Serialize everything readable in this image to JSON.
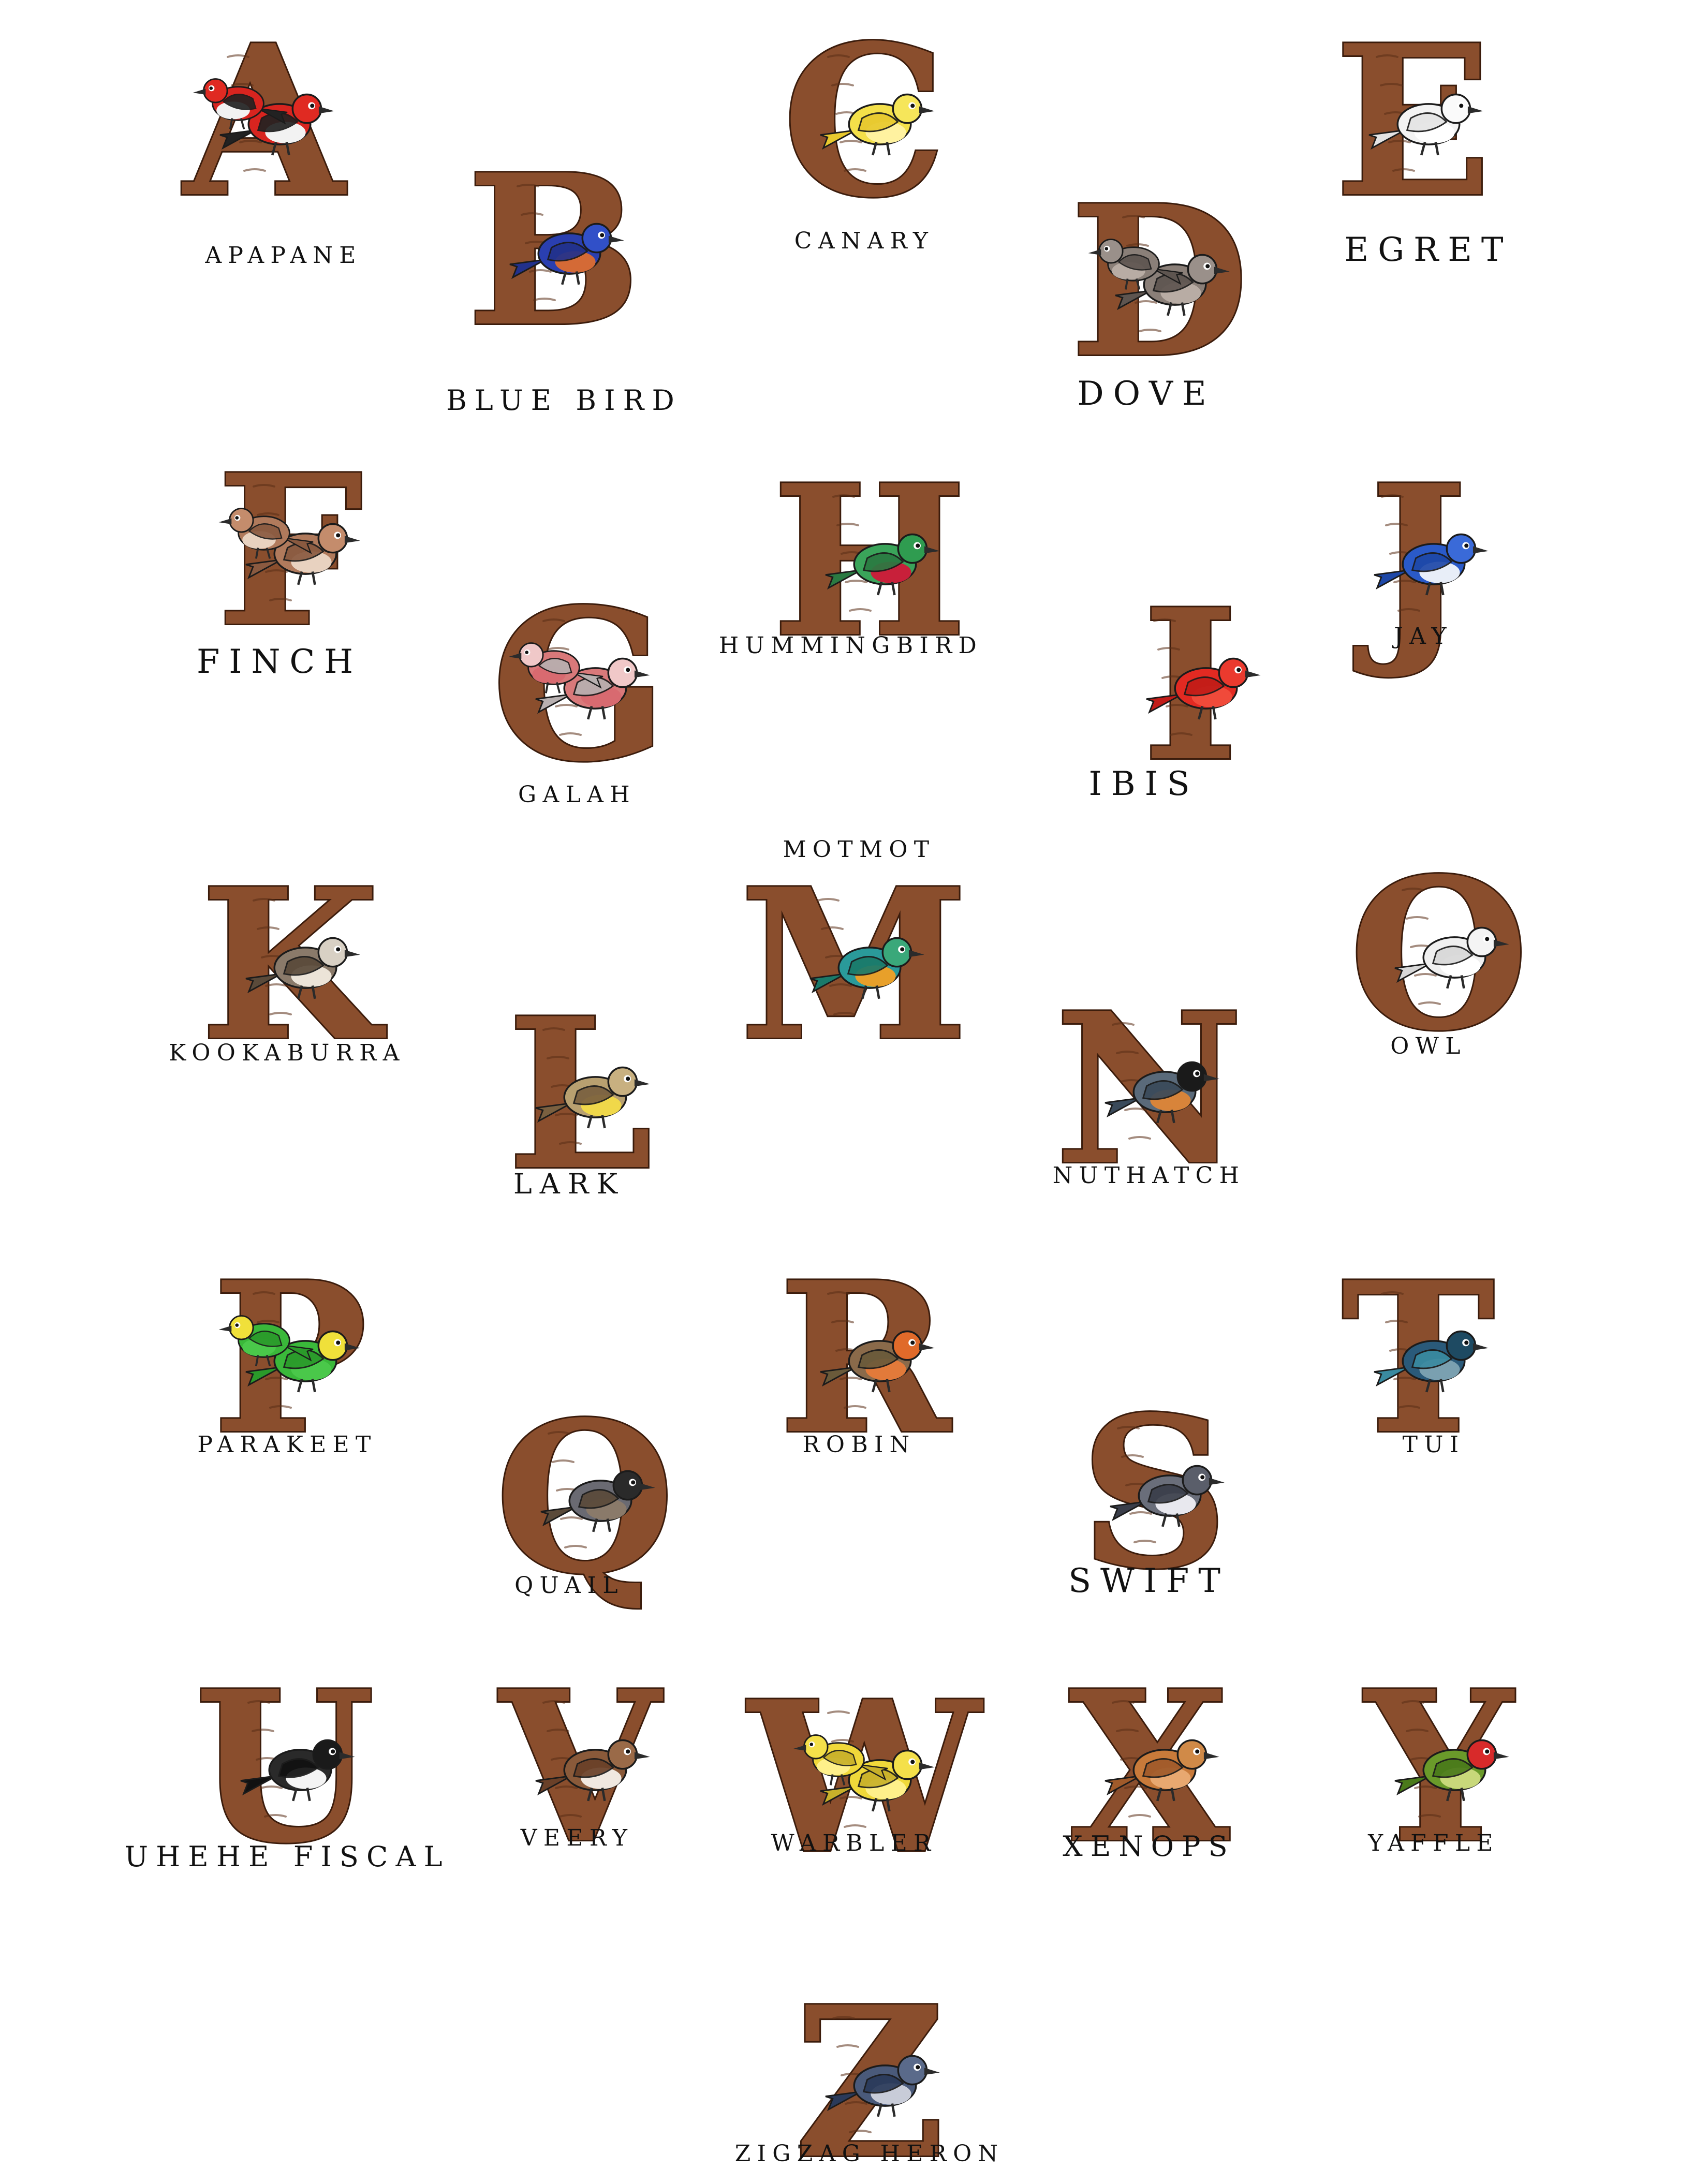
{
  "entries": [
    {
      "letter": "A",
      "name": "Apapane",
      "colors": {
        "body": "#d8241f",
        "wing": "#222222",
        "head": "#e02a22",
        "belly": "#f2f2f2"
      }
    },
    {
      "letter": "B",
      "name": "Blue Bird",
      "colors": {
        "body": "#2a3fb0",
        "wing": "#22318c",
        "head": "#3150c8",
        "belly": "#d46a36"
      }
    },
    {
      "letter": "C",
      "name": "Canary",
      "colors": {
        "body": "#f4e04a",
        "wing": "#e8c92e",
        "head": "#f6e65a",
        "belly": "#fff2a0"
      }
    },
    {
      "letter": "D",
      "name": "Dove",
      "colors": {
        "body": "#8a7f78",
        "wing": "#5e5550",
        "head": "#9a908a",
        "belly": "#b8aca4"
      }
    },
    {
      "letter": "E",
      "name": "Egret",
      "colors": {
        "body": "#f4f4f4",
        "wing": "#e4e4e4",
        "head": "#fafafa",
        "belly": "#ffffff"
      }
    },
    {
      "letter": "F",
      "name": "Finch",
      "colors": {
        "body": "#b07a5c",
        "wing": "#8a5a40",
        "head": "#c48c6c",
        "belly": "#e8d2c0"
      }
    },
    {
      "letter": "G",
      "name": "Galah",
      "colors": {
        "body": "#d9797a",
        "wing": "#b8b0b0",
        "head": "#f0c8c8",
        "belly": "#d86a70"
      }
    },
    {
      "letter": "H",
      "name": "Hummingbird",
      "colors": {
        "body": "#3aa45a",
        "wing": "#2a7a42",
        "head": "#2f9c50",
        "belly": "#c8203a"
      }
    },
    {
      "letter": "I",
      "name": "Ibis",
      "colors": {
        "body": "#e22a22",
        "wing": "#c21c18",
        "head": "#ea3a2e",
        "belly": "#f04a3a"
      }
    },
    {
      "letter": "J",
      "name": "Jay",
      "colors": {
        "body": "#2a5ac8",
        "wing": "#1e48a8",
        "head": "#3a6ad8",
        "belly": "#e8eef8"
      }
    },
    {
      "letter": "K",
      "name": "Kookaburra",
      "colors": {
        "body": "#8a7a6a",
        "wing": "#5a4a3a",
        "head": "#d8d0c4",
        "belly": "#ece4d8"
      }
    },
    {
      "letter": "L",
      "name": "Lark",
      "colors": {
        "body": "#b8a070",
        "wing": "#7a6040",
        "head": "#c8b080",
        "belly": "#f0d84a"
      }
    },
    {
      "letter": "M",
      "name": "Motmot",
      "colors": {
        "body": "#2a9a9a",
        "wing": "#1a7a6a",
        "head": "#3aa87a",
        "belly": "#e8a02a"
      }
    },
    {
      "letter": "N",
      "name": "Nuthatch",
      "colors": {
        "body": "#5a6a7a",
        "wing": "#3a4a5a",
        "head": "#1a1a1a",
        "belly": "#d8843a"
      }
    },
    {
      "letter": "O",
      "name": "Owl",
      "colors": {
        "body": "#f0f0f0",
        "wing": "#d8d8d8",
        "head": "#f4f4f4",
        "belly": "#ffffff"
      }
    },
    {
      "letter": "P",
      "name": "Parakeet",
      "colors": {
        "body": "#3ab83a",
        "wing": "#2a9a2a",
        "head": "#f0e03a",
        "belly": "#4ac84a"
      }
    },
    {
      "letter": "Q",
      "name": "Quail",
      "colors": {
        "body": "#6a6a72",
        "wing": "#5a4a3a",
        "head": "#2a2a2a",
        "belly": "#8a7a6a"
      }
    },
    {
      "letter": "R",
      "name": "Robin",
      "colors": {
        "body": "#8a6a4a",
        "wing": "#6a5a3a",
        "head": "#e06a2a",
        "belly": "#e27a3a"
      }
    },
    {
      "letter": "S",
      "name": "Swift",
      "colors": {
        "body": "#6a6e7a",
        "wing": "#3a3e4a",
        "head": "#5a5e6a",
        "belly": "#e8e8ee"
      }
    },
    {
      "letter": "T",
      "name": "Tui",
      "colors": {
        "body": "#2a5a7a",
        "wing": "#3a8aa0",
        "head": "#1e4a62",
        "belly": "#7aa0b0"
      }
    },
    {
      "letter": "U",
      "name": "Uhehe Fiscal",
      "colors": {
        "body": "#2a2a2a",
        "wing": "#111111",
        "head": "#1a1a1a",
        "belly": "#f4f4f4"
      }
    },
    {
      "letter": "V",
      "name": "Veery",
      "colors": {
        "body": "#8a5a3a",
        "wing": "#6a4028",
        "head": "#9a6a48",
        "belly": "#f0e8e0"
      }
    },
    {
      "letter": "W",
      "name": "Warbler",
      "colors": {
        "body": "#f0d83a",
        "wing": "#c8b02a",
        "head": "#f4e04a",
        "belly": "#fff08a"
      }
    },
    {
      "letter": "X",
      "name": "Xenops",
      "colors": {
        "body": "#c87a3a",
        "wing": "#a05a2a",
        "head": "#d08a48",
        "belly": "#e8a870"
      }
    },
    {
      "letter": "Y",
      "name": "Yaffle",
      "colors": {
        "body": "#6a9a2a",
        "wing": "#4a7a1a",
        "head": "#d82a2a",
        "belly": "#c8d87a"
      }
    },
    {
      "letter": "Z",
      "name": "Zigzag Heron",
      "colors": {
        "body": "#4a5a7a",
        "wing": "#2a3a5a",
        "head": "#5a6a8a",
        "belly": "#c8ccd8"
      }
    }
  ],
  "colors": {
    "branch_fill": "#8a4e2d",
    "branch_outline": "#3b1c0c",
    "caption_text": "#111111"
  }
}
